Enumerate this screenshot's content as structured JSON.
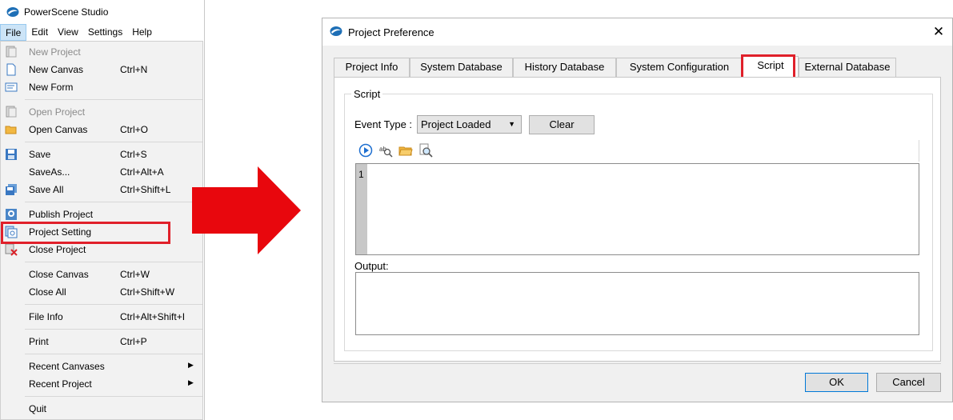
{
  "app": {
    "title": "PowerScene Studio",
    "menubar": [
      "File",
      "Edit",
      "View",
      "Settings",
      "Help"
    ],
    "file_menu": [
      {
        "label": "New Project",
        "shortcut": "",
        "icon": "new-project-icon",
        "disabled": true
      },
      {
        "label": "New Canvas",
        "shortcut": "Ctrl+N",
        "icon": "new-canvas-icon"
      },
      {
        "label": "New Form",
        "shortcut": "",
        "icon": "new-form-icon"
      },
      {
        "label": "Open Project",
        "shortcut": "",
        "icon": "open-project-icon",
        "disabled": true
      },
      {
        "label": "Open Canvas",
        "shortcut": "Ctrl+O",
        "icon": "folder-icon"
      },
      {
        "label": "Save",
        "shortcut": "Ctrl+S",
        "icon": "save-icon"
      },
      {
        "label": "SaveAs...",
        "shortcut": "Ctrl+Alt+A",
        "icon": ""
      },
      {
        "label": "Save All",
        "shortcut": "Ctrl+Shift+L",
        "icon": "save-all-icon"
      },
      {
        "label": "Publish Project",
        "shortcut": "",
        "icon": "publish-icon"
      },
      {
        "label": "Project Setting",
        "shortcut": "",
        "icon": "project-setting-icon"
      },
      {
        "label": "Close Project",
        "shortcut": "",
        "icon": "close-project-icon"
      },
      {
        "label": "Close Canvas",
        "shortcut": "Ctrl+W",
        "icon": ""
      },
      {
        "label": "Close All",
        "shortcut": "Ctrl+Shift+W",
        "icon": ""
      },
      {
        "label": "File Info",
        "shortcut": "Ctrl+Alt+Shift+I",
        "icon": ""
      },
      {
        "label": "Print",
        "shortcut": "Ctrl+P",
        "icon": ""
      },
      {
        "label": "Recent Canvases",
        "shortcut": "",
        "icon": "",
        "submenu": true
      },
      {
        "label": "Recent Project",
        "shortcut": "",
        "icon": "",
        "submenu": true
      },
      {
        "label": "Quit",
        "shortcut": "",
        "icon": ""
      }
    ],
    "highlight_color": "#e0202a"
  },
  "dialog": {
    "title": "Project Preference",
    "close_glyph": "✕",
    "tabs": [
      "Project Info",
      "System Database",
      "History Database",
      "System Configuration",
      "Script",
      "External Database"
    ],
    "active_tab": "Script",
    "group_title": "Script",
    "event_type_label": "Event Type :",
    "event_type_value": "Project Loaded",
    "clear_label": "Clear",
    "toolbar_icons": [
      "run-icon",
      "find-icon",
      "open-folder-icon",
      "search-icon"
    ],
    "line_number": "1",
    "output_label": "Output:",
    "ok_label": "OK",
    "cancel_label": "Cancel"
  }
}
